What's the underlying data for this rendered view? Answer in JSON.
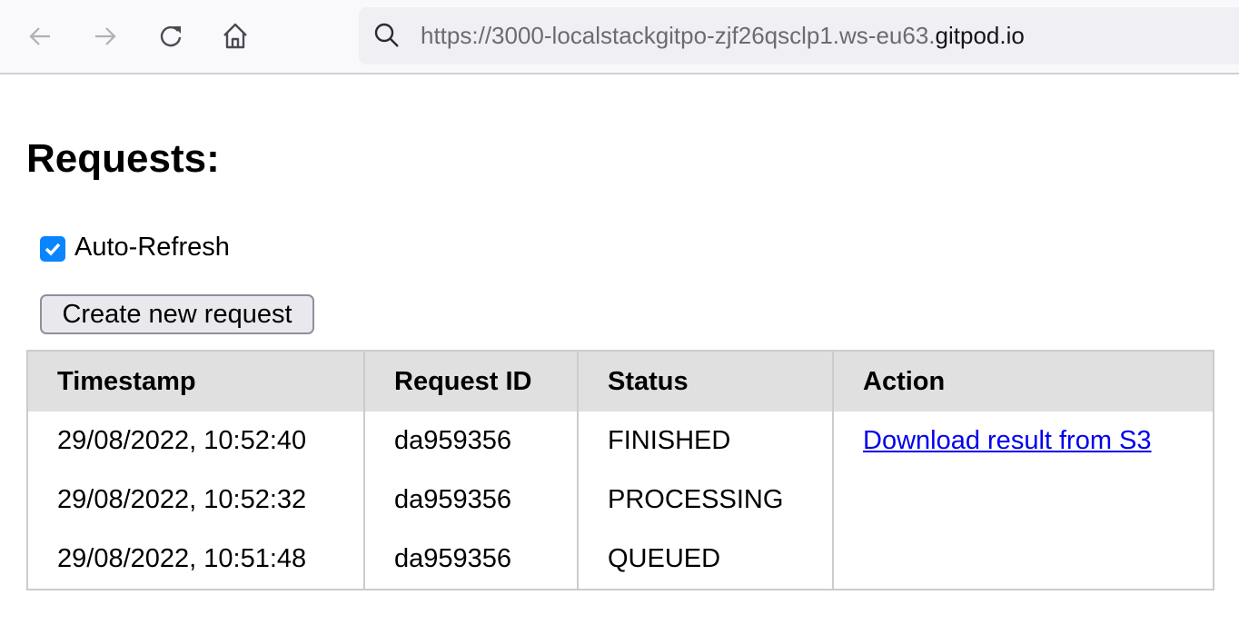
{
  "browser": {
    "url_prefix": "https://3000-localstackgitpo-zjf26qsclp1.ws-eu63.",
    "url_host": "gitpod.io",
    "icons": [
      "back-icon",
      "forward-icon",
      "reload-icon",
      "home-icon",
      "search-icon"
    ]
  },
  "page": {
    "title": "Requests:",
    "auto_refresh_label": "Auto-Refresh",
    "auto_refresh_checked": true,
    "create_button": "Create new request"
  },
  "table": {
    "headers": [
      "Timestamp",
      "Request ID",
      "Status",
      "Action"
    ],
    "rows": [
      {
        "timestamp": "29/08/2022, 10:52:40",
        "id": "da959356",
        "status": "FINISHED",
        "action": "Download result from S3"
      },
      {
        "timestamp": "29/08/2022, 10:52:32",
        "id": "da959356",
        "status": "PROCESSING",
        "action": ""
      },
      {
        "timestamp": "29/08/2022, 10:51:48",
        "id": "da959356",
        "status": "QUEUED",
        "action": ""
      }
    ]
  },
  "colors": {
    "accent": "#0a84ff",
    "link": "#0000ee",
    "header_bg": "#e0e0e0"
  }
}
